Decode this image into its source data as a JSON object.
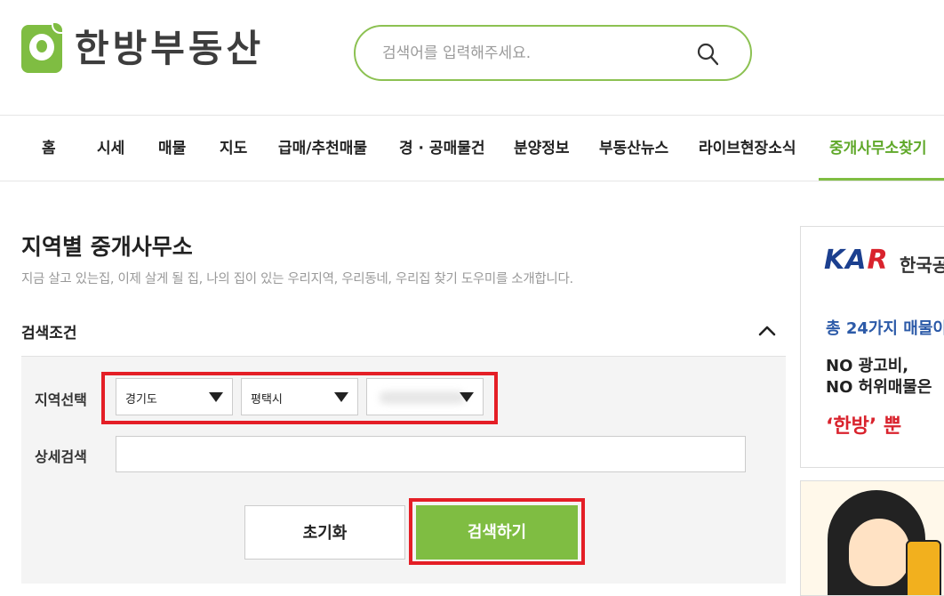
{
  "header": {
    "logo_text": "한방부동산",
    "search_placeholder": "검색어를 입력해주세요."
  },
  "nav": {
    "items": [
      "홈",
      "시세",
      "매물",
      "지도",
      "급매/추천매물",
      "경 · 공매물건",
      "분양정보",
      "부동산뉴스",
      "라이브현장소식",
      "중개사무소찾기"
    ],
    "active_index": 9,
    "accent_color": "#7fbd42"
  },
  "main": {
    "title": "지역별 중개사무소",
    "description": "지금 살고 있는집, 이제 살게 될 집, 나의 집이 있는 우리지역, 우리동네, 우리집 찾기 도우미를 소개합니다.",
    "search_conditions_label": "검색조건",
    "region_label": "지역선택",
    "region_selects": [
      "경기도",
      "평택시",
      ""
    ],
    "detail_label": "상세검색",
    "detail_value": "",
    "reset_button": "초기화",
    "search_button": "검색하기"
  },
  "side_ad": {
    "brand": "KAR",
    "org": "한국공",
    "line1": "총 24가지 매물이",
    "line2": "NO 광고비,",
    "line3": "NO 허위매물은",
    "line4": "‘한방’ 뿐"
  },
  "highlight_color": "#e41e26"
}
